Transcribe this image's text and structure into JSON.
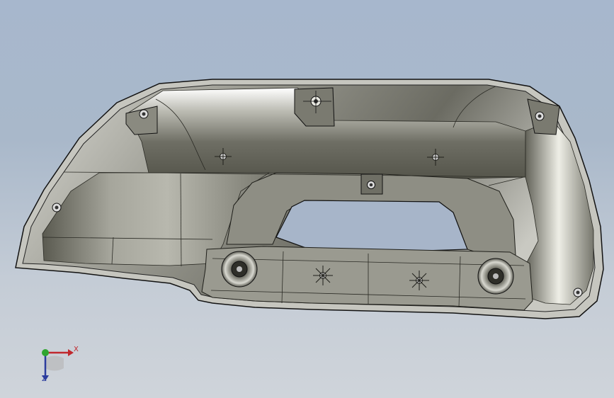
{
  "viewport": {
    "background_top": "#a7b7cd",
    "background_bottom": "#cfd4da"
  },
  "model": {
    "name": "molded-plastic-housing",
    "shell_light": "#e6e6e0",
    "shell_mid": "#8f8f86",
    "shell_dark": "#3c3c34",
    "edge_color": "#111111"
  },
  "triad": {
    "x_label": "X",
    "z_label": "Z",
    "x_color": "#c0282d",
    "y_color": "#2fa52f",
    "z_color": "#2c3d9e"
  }
}
